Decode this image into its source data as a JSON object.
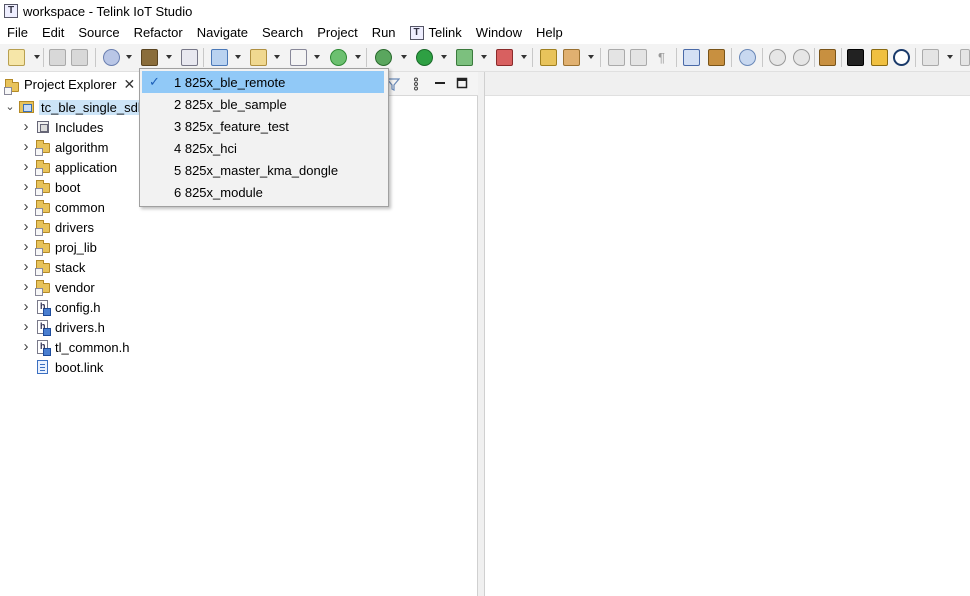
{
  "window": {
    "title": "workspace - Telink IoT Studio",
    "app_badge": "T"
  },
  "menubar": {
    "items": [
      "File",
      "Edit",
      "Source",
      "Refactor",
      "Navigate",
      "Search",
      "Project",
      "Run",
      "Telink",
      "Window",
      "Help"
    ],
    "telink_badge": "T"
  },
  "explorer": {
    "tab_label": "Project Explorer",
    "root": "tc_ble_single_sdk",
    "children": [
      {
        "label": "Includes",
        "icon": "includes-icon",
        "expandable": true
      },
      {
        "label": "algorithm",
        "icon": "folder-icon",
        "expandable": true
      },
      {
        "label": "application",
        "icon": "folder-icon",
        "expandable": true
      },
      {
        "label": "boot",
        "icon": "folder-icon",
        "expandable": true
      },
      {
        "label": "common",
        "icon": "folder-icon",
        "expandable": true
      },
      {
        "label": "drivers",
        "icon": "folder-icon",
        "expandable": true
      },
      {
        "label": "proj_lib",
        "icon": "folder-icon",
        "expandable": true
      },
      {
        "label": "stack",
        "icon": "folder-icon",
        "expandable": true
      },
      {
        "label": "vendor",
        "icon": "folder-icon",
        "expandable": true
      },
      {
        "label": "config.h",
        "icon": "header-file-icon",
        "expandable": true
      },
      {
        "label": "drivers.h",
        "icon": "header-file-icon",
        "expandable": true
      },
      {
        "label": "tl_common.h",
        "icon": "header-file-icon",
        "expandable": true
      },
      {
        "label": "boot.link",
        "icon": "link-file-icon",
        "expandable": false
      }
    ]
  },
  "build_config_menu": {
    "items": [
      {
        "label": "1 825x_ble_remote",
        "checked": true
      },
      {
        "label": "2 825x_ble_sample",
        "checked": false
      },
      {
        "label": "3 825x_feature_test",
        "checked": false
      },
      {
        "label": "4 825x_hci",
        "checked": false
      },
      {
        "label": "5 825x_master_kma_dongle",
        "checked": false
      },
      {
        "label": "6 825x_module",
        "checked": false
      }
    ],
    "check_glyph": "✓"
  },
  "colors": {
    "selection": "#91c9f7",
    "tree_selection": "#cce4f7",
    "toolbar_bg": "#f3f3f3"
  }
}
